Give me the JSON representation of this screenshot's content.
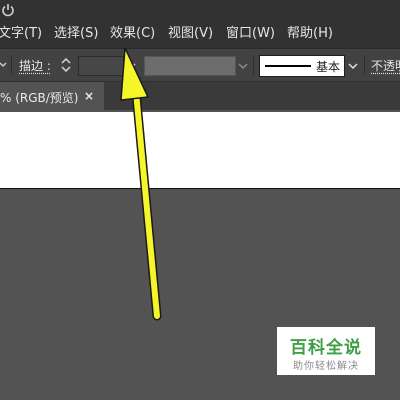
{
  "menubar": {
    "items": [
      "文字(T)",
      "选择(S)",
      "效果(C)",
      "视图(V)",
      "窗口(W)",
      "帮助(H)"
    ]
  },
  "controlbar": {
    "stroke_label": "描边 :",
    "stroke_value": "",
    "brush_label": "基本",
    "opacity_label": "不透明"
  },
  "tab": {
    "label": "% (RGB/预览)",
    "close": "×"
  },
  "watermark": {
    "title": "百科全说",
    "subtitle": "助你轻松解决"
  },
  "colors": {
    "chrome_dark": "#323232",
    "control_bar": "#424242",
    "workspace": "#535353",
    "artboard": "#ffffff",
    "arrow": "#f5f52a",
    "watermark_green": "#3e9f47"
  },
  "icons": {
    "power": "power-icon",
    "close": "close-icon",
    "chevron": "chevron-down-icon",
    "spinner": "spinner-icon",
    "arrow": "annotation-arrow-icon"
  }
}
